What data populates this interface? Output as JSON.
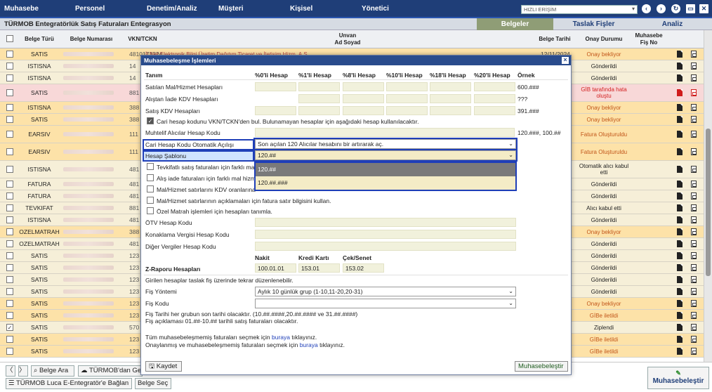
{
  "menu": [
    "Muhasebe",
    "Personel",
    "Denetim/Analiz",
    "Müşteri",
    "Kişisel",
    "Yönetici"
  ],
  "quick_access": "HIZLI ERİŞİM",
  "app_title": "TÜRMOB Entegratörlük Satış Faturaları Entegrasyon",
  "tabs": [
    "Belgeler",
    "Taslak Fişler",
    "Analiz"
  ],
  "columns": {
    "type": "Belge Türü",
    "number": "Belge Numarası",
    "vkn": "VKN/TCKN",
    "unvan": "Unvan",
    "adsoyad": "Ad Soyad",
    "date": "Belge Tarihi",
    "status": "Onay Durumu",
    "fis": "Muhasebe",
    "fis2": "Fiş No"
  },
  "rows": [
    {
      "type": "SATIS",
      "vkn": "4810173324",
      "unvan": "İl Net Elektronik Bilgi Üretim Dağıtım Ticaret ve İletişim Hizm. A.Ş.",
      "date": "12/11/2024",
      "status": "Onay bekliyor",
      "checked": false
    },
    {
      "type": "ISTISNA",
      "vkn": "14",
      "unvan": "",
      "date": "",
      "status": "Gönderildi",
      "checked": false
    },
    {
      "type": "ISTISNA",
      "vkn": "14",
      "unvan": "",
      "date": "",
      "status": "Gönderildi",
      "checked": false
    },
    {
      "type": "SATIS",
      "vkn": "881",
      "unvan": "",
      "date": "",
      "status": "GİB tarafında hata oluştu",
      "checked": false
    },
    {
      "type": "ISTISNA",
      "vkn": "388",
      "unvan": "",
      "date": "",
      "status": "Onay bekliyor",
      "checked": false
    },
    {
      "type": "SATIS",
      "vkn": "388",
      "unvan": "",
      "date": "",
      "status": "Onay bekliyor",
      "checked": false
    },
    {
      "type": "EARSIV",
      "vkn": "111",
      "unvan": "",
      "date": "",
      "status": "Fatura Oluşturuldu",
      "checked": false
    },
    {
      "type": "EARSIV",
      "vkn": "111",
      "unvan": "",
      "date": "",
      "status": "Fatura Oluşturuldu",
      "checked": false
    },
    {
      "type": "ISTISNA",
      "vkn": "481",
      "unvan": "",
      "date": "",
      "status": "Otomatik alıcı kabul etti",
      "checked": false
    },
    {
      "type": "FATURA",
      "vkn": "481",
      "unvan": "",
      "date": "",
      "status": "Gönderildi",
      "checked": false
    },
    {
      "type": "FATURA",
      "vkn": "481",
      "unvan": "",
      "date": "",
      "status": "Gönderildi",
      "checked": false
    },
    {
      "type": "TEVKIFAT",
      "vkn": "881",
      "unvan": "",
      "date": "",
      "status": "Alıcı kabul etti",
      "checked": false
    },
    {
      "type": "ISTISNA",
      "vkn": "481",
      "unvan": "",
      "date": "",
      "status": "Gönderildi",
      "checked": false
    },
    {
      "type": "OZELMATRAH",
      "vkn": "388",
      "unvan": "",
      "date": "",
      "status": "Onay bekliyor",
      "checked": false
    },
    {
      "type": "OZELMATRAH",
      "vkn": "481",
      "unvan": "",
      "date": "",
      "status": "Gönderildi",
      "checked": false
    },
    {
      "type": "SATIS",
      "vkn": "123",
      "unvan": "",
      "date": "",
      "status": "Gönderildi",
      "checked": false
    },
    {
      "type": "SATIS",
      "vkn": "123",
      "unvan": "",
      "date": "",
      "status": "Gönderildi",
      "checked": false
    },
    {
      "type": "SATIS",
      "vkn": "123",
      "unvan": "",
      "date": "",
      "status": "Gönderildi",
      "checked": false
    },
    {
      "type": "SATIS",
      "vkn": "123",
      "unvan": "",
      "date": "",
      "status": "Gönderildi",
      "checked": false
    },
    {
      "type": "SATIS",
      "vkn": "123",
      "unvan": "",
      "date": "",
      "status": "Onay bekliyor",
      "checked": false
    },
    {
      "type": "SATIS",
      "vkn": "123",
      "unvan": "",
      "date": "",
      "status": "GİBe iletildi",
      "checked": false
    },
    {
      "type": "SATIS",
      "vkn": "570",
      "unvan": "",
      "date": "",
      "status": "Ziplendi",
      "checked": true
    },
    {
      "type": "SATIS",
      "vkn": "123",
      "unvan": "",
      "date": "",
      "status": "GİBe iletildi",
      "checked": false
    },
    {
      "type": "SATIS",
      "vkn": "123",
      "unvan": "",
      "date": "",
      "status": "GİBe iletildi",
      "checked": false
    }
  ],
  "bottom": {
    "belge_ara": "Belge Ara",
    "turmob_den_ge": "TÜRMOB'dan Ge",
    "luca_baglan": "TÜRMOB Luca E-Entegratör'e Bağlan",
    "belge_sec": "Belge Seç",
    "muhasebelestir": "Muhasebeleştir"
  },
  "modal": {
    "title": "Muhasebeleşme İşlemleri",
    "headers": [
      "Tanım",
      "%0'li Hesap",
      "%1'li Hesap",
      "%8'li Hesap",
      "%10'li Hesap",
      "%18'li Hesap",
      "%20'li Hesap",
      "Örnek"
    ],
    "rows": [
      {
        "label": "Satılan Mal/Hizmet Hesapları",
        "example": "600.###"
      },
      {
        "label": "Alıştan İade KDV Hesapları",
        "example": "???"
      },
      {
        "label": "Satış KDV Hesapları",
        "example": "391.###"
      }
    ],
    "cari_check": "Cari hesap kodunu VKN/TCKN'den bul. Bulunamayan hesaplar için aşağıdaki hesap kullanılacaktır.",
    "muhtelif_label": "Muhtelif Alıcılar Hesap Kodu",
    "muhtelif_example": "120.###, 100.##",
    "cari_auto_label": "Cari Hesap Kodu Otomatik Açılışı",
    "cari_auto_value": "Son açılan 120 Alıcılar hesabını bir artırarak aç.",
    "sablon_label": "Hesap Şablonu",
    "sablon_value": "120.##",
    "sablon_options": [
      "120.##",
      "120.##.###"
    ],
    "checks": [
      "Tevkifatlı satış faturaları için farklı ma",
      "Alış iade faturaları için farklı mal hizm",
      "Mal/Hizmet satırlarını KDV oranlarına",
      "Mal/Hizmet satırlarının açıklamaları için fatura satır bilgisini kullan.",
      "Özel Matrah işlemleri için hesapları tanımla."
    ],
    "otv_label": "ÖTV Hesap Kodu",
    "konak_label": "Konaklama Vergisi Hesap Kodu",
    "diger_label": "Diğer Vergiler Hesap Kodu",
    "z_headers": [
      "Nakit",
      "Kredi Kartı",
      "Çek/Senet"
    ],
    "z_label": "Z-Raporu Hesapları",
    "z_values": [
      "100.01.01",
      "153.01",
      "153.02"
    ],
    "note1": "Girilen hesaplar taslak fiş üzerinde tekrar düzenlenebilir.",
    "fis_yontemi_label": "Fiş Yöntemi",
    "fis_yontemi_value": "Aylık 10 günlük grup (1-10,11-20,20-31)",
    "fis_kodu_label": "Fiş Kodu",
    "note2": "Fiş Tarihi her grubun son tarihi olacaktır. (10.##.####,20.##.#### ve 31.##.####)",
    "note3": "Fiş açıklaması 01.##-10.## tarihli satış faturaları olacaktır.",
    "link1_pre": "Tüm muhasebeleşmemiş faturaları seçmek için",
    "link1": "buraya",
    "link1_post": "tıklayınız.",
    "link2_pre": "Onaylanmış ve muhasebeleşmemiş faturaları seçmek için",
    "link2": "buraya",
    "link2_post": "tıklayınız.",
    "save": "Kaydet",
    "muhasebelestir": "Muhasebeleştir"
  },
  "colors": {
    "topbar": "#1f3e78",
    "accent_tab": "#8f9d76",
    "row_orange": "#fde2a8",
    "row_beige": "#f6efd8",
    "row_error": "#f8d8d8",
    "highlight": "#1f3fb8"
  }
}
